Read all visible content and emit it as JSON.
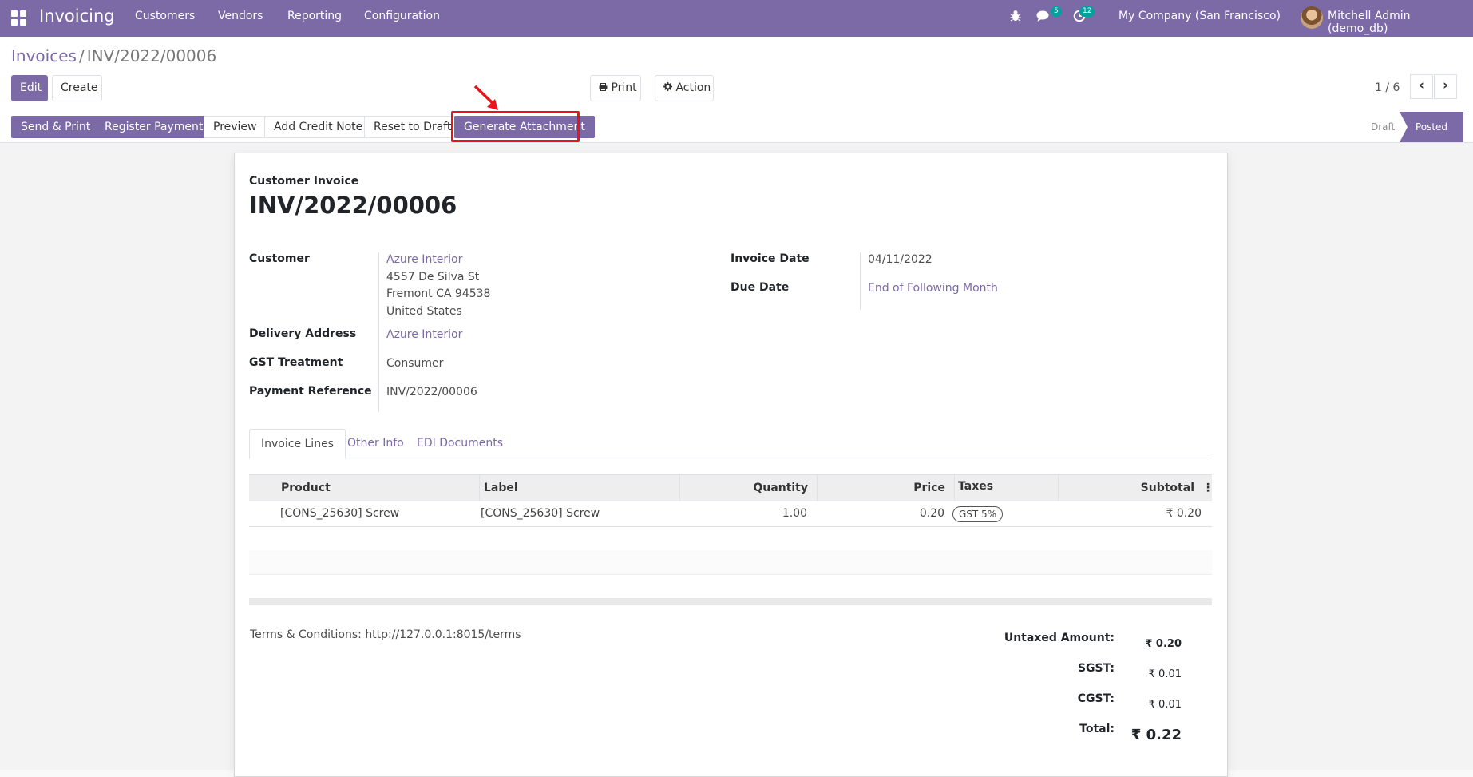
{
  "navbar": {
    "app_name": "Invoicing",
    "menu": [
      "Customers",
      "Vendors",
      "Reporting",
      "Configuration"
    ],
    "messages_count": "5",
    "activities_count": "12",
    "company": "My Company (San Francisco)",
    "user": "Mitchell Admin (demo_db)",
    "colors": {
      "brand": "#7c6aa6",
      "badge": "#00a09d"
    }
  },
  "breadcrumb": {
    "parent": "Invoices",
    "separator": "/",
    "current": "INV/2022/00006"
  },
  "toolbar": {
    "edit_label": "Edit",
    "create_label": "Create",
    "print_label": "Print",
    "action_label": "Action",
    "pager": "1 / 6"
  },
  "statusbar": {
    "buttons": [
      "Send & Print",
      "Register Payment",
      "Preview",
      "Add Credit Note",
      "Reset to Draft",
      "Generate Attachment"
    ],
    "stages": [
      "Draft",
      "Posted"
    ],
    "active_stage": "Posted",
    "highlight_color": "#e8131b"
  },
  "invoice": {
    "type_label": "Customer Invoice",
    "number": "INV/2022/00006",
    "fields_left": {
      "customer_label": "Customer",
      "customer_name": "Azure Interior",
      "customer_address": [
        "4557 De Silva St",
        "Fremont CA 94538",
        "United States"
      ],
      "delivery_label": "Delivery Address",
      "delivery_value": "Azure Interior",
      "gst_label": "GST Treatment",
      "gst_value": "Consumer",
      "payref_label": "Payment Reference",
      "payref_value": "INV/2022/00006"
    },
    "fields_right": {
      "invoice_date_label": "Invoice Date",
      "invoice_date_value": "04/11/2022",
      "due_date_label": "Due Date",
      "due_date_value": "End of Following Month"
    },
    "tabs": [
      "Invoice Lines",
      "Other Info",
      "EDI Documents"
    ],
    "lines": {
      "columns": [
        "Product",
        "Label",
        "Quantity",
        "Price",
        "Taxes",
        "Subtotal"
      ],
      "rows": [
        {
          "product": "[CONS_25630] Screw",
          "label": "[CONS_25630] Screw",
          "quantity": "1.00",
          "price": "0.20",
          "taxes": "GST 5%",
          "subtotal": "₹ 0.20"
        }
      ]
    },
    "terms": "Terms & Conditions: http://127.0.0.1:8015/terms",
    "totals": {
      "untaxed_label": "Untaxed Amount:",
      "untaxed_value": "₹ 0.20",
      "sgst_label": "SGST:",
      "sgst_value": "₹ 0.01",
      "cgst_label": "CGST:",
      "cgst_value": "₹ 0.01",
      "total_label": "Total:",
      "total_value": "₹ 0.22"
    }
  }
}
